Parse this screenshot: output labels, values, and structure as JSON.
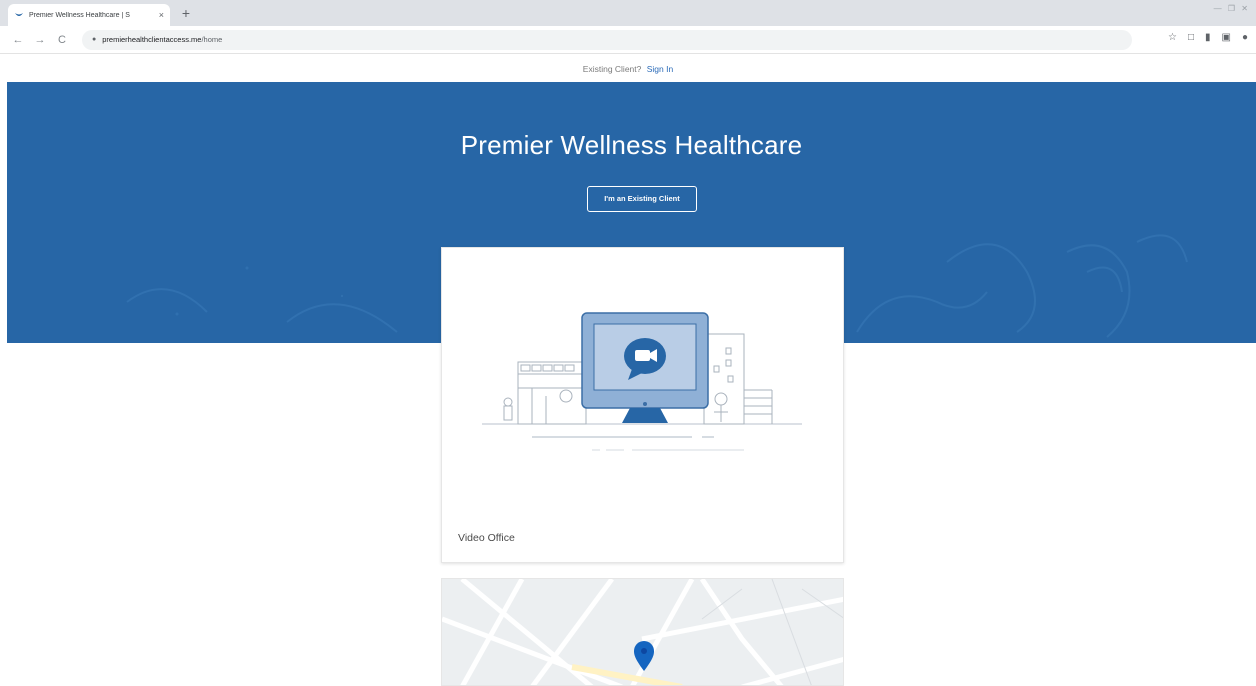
{
  "browser": {
    "tab_title": "Premier Wellness Healthcare | S",
    "tab_close": "×",
    "new_tab": "+",
    "window_controls": "— ❐ ✕",
    "back": "←",
    "forward": "→",
    "reload": "C",
    "url_host": "premierhealthclientaccess.me",
    "url_path": "/home"
  },
  "page": {
    "existing_client_text": "Existing Client?",
    "sign_in_link": "Sign In",
    "hero_title": "Premier Wellness Healthcare",
    "hero_button": "I'm an Existing Client",
    "card_label": "Video Office"
  },
  "colors": {
    "hero_blue": "#2766a6",
    "link_blue": "#2b6bb8",
    "pin_blue": "#1565c0"
  },
  "icons": [
    "favicon-icon",
    "lock-icon",
    "star-icon",
    "extension-icon",
    "menu-icon",
    "chat-bubble-icon",
    "map-pin-icon"
  ]
}
